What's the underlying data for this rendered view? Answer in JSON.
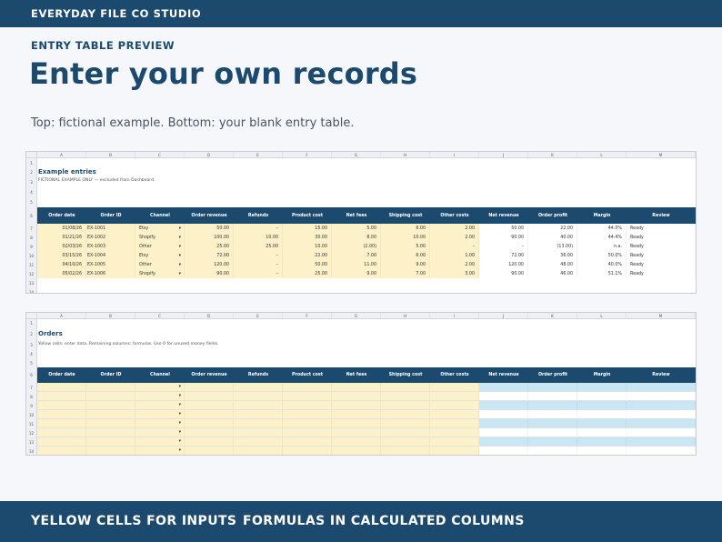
{
  "brand": "EVERYDAY FILE CO STUDIO",
  "eyebrow": "ENTRY TABLE PREVIEW",
  "headline": "Enter your own records",
  "subtitle": "Top: fictional example. Bottom: your blank entry table.",
  "columns": [
    "A",
    "B",
    "C",
    "D",
    "E",
    "F",
    "G",
    "H",
    "I",
    "J",
    "K",
    "L",
    "M"
  ],
  "headers": [
    "Order date",
    "Order ID",
    "Channel",
    "Order revenue",
    "Refunds",
    "Product cost",
    "Net fees",
    "Shipping cost",
    "Other costs",
    "Net revenue",
    "Order profit",
    "Margin",
    "Review"
  ],
  "example": {
    "title": "Example entries",
    "note": "FICTIONAL EXAMPLE ONLY — excluded from Dashboard.",
    "row_numbers": [
      "1",
      "2",
      "3",
      "4",
      "5",
      "6",
      "7",
      "8",
      "9",
      "10",
      "11",
      "12",
      "13",
      "14"
    ],
    "rows": [
      [
        "01/08/26",
        "EX-1001",
        "Etsy",
        "50.00",
        "–",
        "15.00",
        "5.00",
        "6.00",
        "2.00",
        "50.00",
        "22.00",
        "44.0%",
        "Ready"
      ],
      [
        "01/21/26",
        "EX-1002",
        "Shopify",
        "100.00",
        "10.00",
        "30.00",
        "8.00",
        "10.00",
        "2.00",
        "90.00",
        "40.00",
        "44.4%",
        "Ready"
      ],
      [
        "02/03/26",
        "EX-1003",
        "Other",
        "25.00",
        "25.00",
        "10.00",
        "(2.00)",
        "5.00",
        "–",
        "–",
        "(13.00)",
        "n.a.",
        "Ready"
      ],
      [
        "03/15/26",
        "EX-1004",
        "Etsy",
        "72.00",
        "–",
        "22.00",
        "7.00",
        "6.00",
        "1.00",
        "72.00",
        "36.00",
        "50.0%",
        "Ready"
      ],
      [
        "04/10/26",
        "EX-1005",
        "Other",
        "120.00",
        "–",
        "50.00",
        "11.00",
        "9.00",
        "2.00",
        "120.00",
        "48.00",
        "40.0%",
        "Ready"
      ],
      [
        "05/02/26",
        "EX-1006",
        "Shopify",
        "90.00",
        "–",
        "25.00",
        "9.00",
        "7.00",
        "3.00",
        "90.00",
        "46.00",
        "51.1%",
        "Ready"
      ]
    ]
  },
  "orders": {
    "title": "Orders",
    "note": "Yellow cells: enter data. Remaining columns: formulas. Use 0 for unused money fields.",
    "row_numbers": [
      "1",
      "2",
      "3",
      "4",
      "5",
      "6",
      "7",
      "8",
      "9",
      "10",
      "11",
      "12",
      "13",
      "14"
    ]
  },
  "dropdown_glyph": "▾",
  "footer": {
    "left": "YELLOW CELLS FOR INPUTS",
    "right": "FORMULAS IN CALCULATED COLUMNS"
  },
  "colors": {
    "brand_navy": "#1b4a6e",
    "input_yellow": "#fdf1c9",
    "calc_blue": "#c9e6f5",
    "page_bg": "#f5f7fb"
  }
}
